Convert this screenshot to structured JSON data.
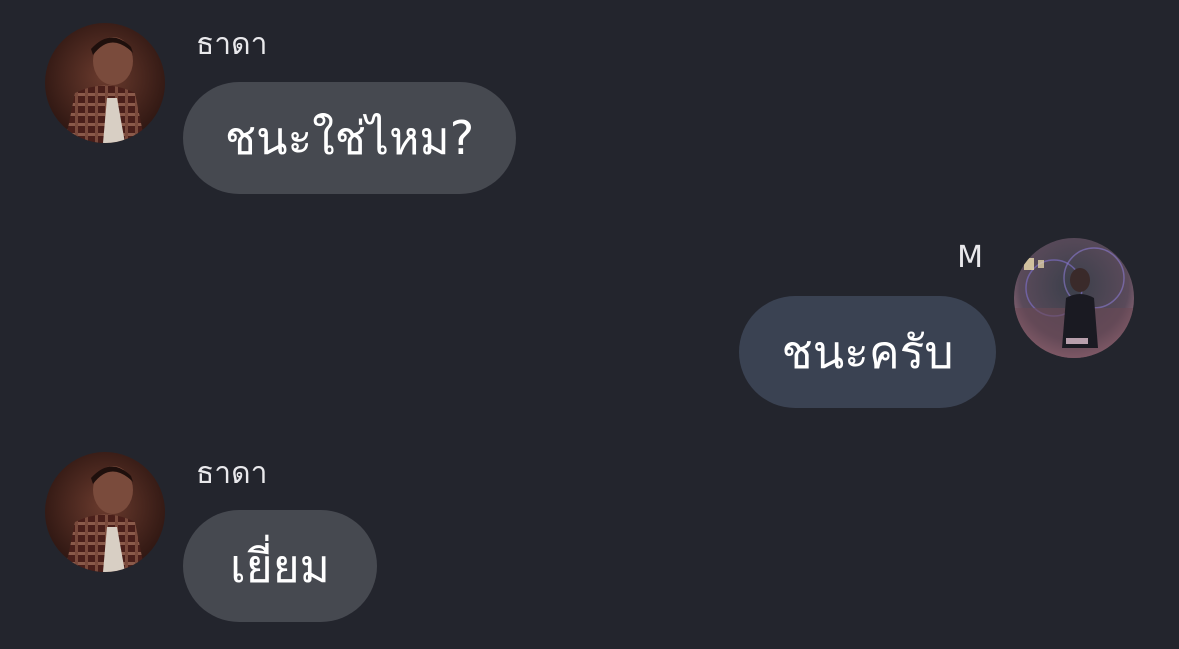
{
  "messages": [
    {
      "sender": "ธาดา",
      "text": "ชนะใช่ไหม?",
      "direction": "incoming"
    },
    {
      "sender": "M",
      "text": "ชนะครับ",
      "direction": "outgoing"
    },
    {
      "sender": "ธาดา",
      "text": "เยี่ยม",
      "direction": "incoming"
    }
  ],
  "colors": {
    "background": "#23252d",
    "incoming_bubble": "#464950",
    "outgoing_bubble": "#3a4252",
    "text": "#ffffff"
  }
}
